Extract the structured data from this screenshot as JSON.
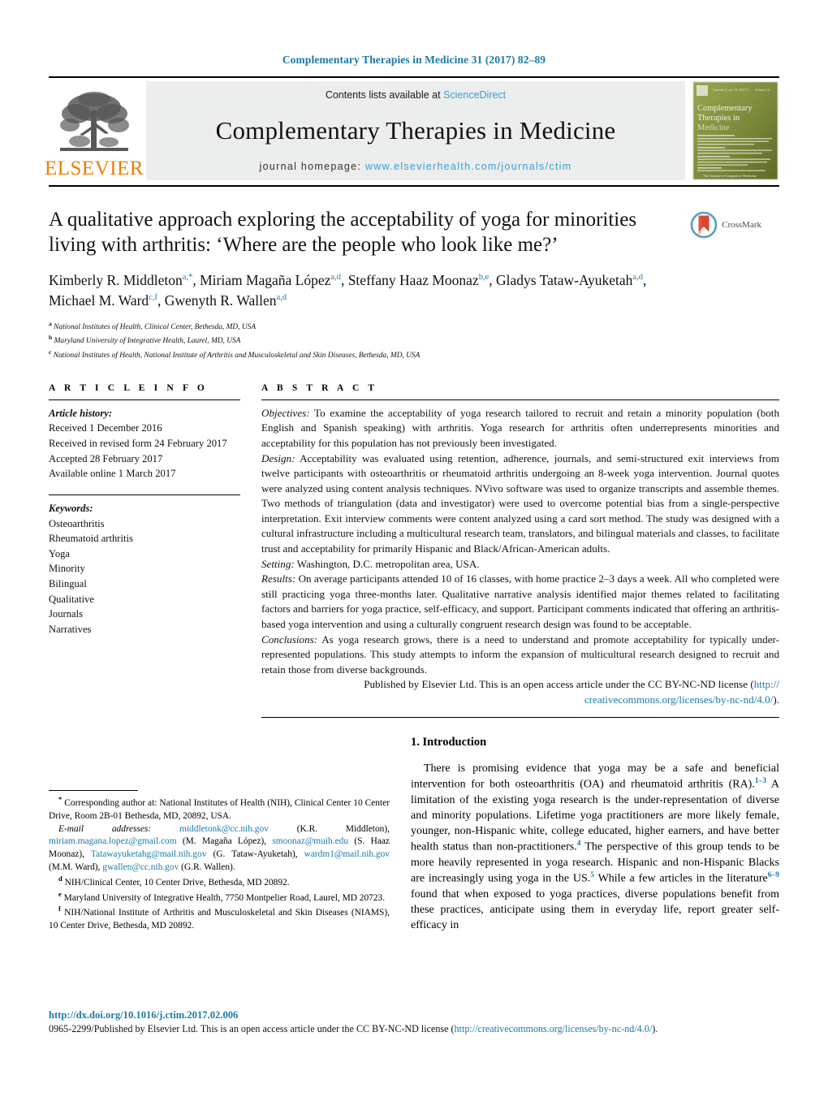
{
  "running_head": "Complementary Therapies in Medicine 31 (2017) 82–89",
  "masthead": {
    "publisher_name": "ELSEVIER",
    "contents_prefix": "Contents lists available at ",
    "contents_link": "ScienceDirect",
    "journal_title": "Complementary Therapies in Medicine",
    "homepage_prefix": "journal homepage: ",
    "homepage_url": "www.elsevierhealth.com/journals/ctim",
    "cover_title_line1": "Complementary",
    "cover_title_line2": "Therapies in",
    "cover_title_line3": "Medicine",
    "link_color": "#3a9fd0"
  },
  "crossmark": {
    "label": "CrossMark"
  },
  "article": {
    "title": "A qualitative approach exploring the acceptability of yoga for minorities living with arthritis: ‘Where are the people who look like me?’",
    "authors_html": "Kimberly R. Middleton<sup class=\"aff\">a,<span class=\"aff-black\">*</span></sup>, Miriam Magaña López<sup class=\"aff\">a,d</sup>, Steffany Haaz Moonaz<sup class=\"aff\">b,e</sup>, Gladys Tataw-Ayuketah<sup class=\"aff\">a,d</sup>, Michael M. Ward<sup class=\"aff\">c,f</sup>, Gwenyth R. Wallen<sup class=\"aff\">a,d</sup>",
    "affiliations": [
      {
        "marker": "a",
        "text": "National Institutes of Health, Clinical Center, Bethesda, MD, USA"
      },
      {
        "marker": "b",
        "text": "Maryland University of Integrative Health, Laurel, MD, USA"
      },
      {
        "marker": "c",
        "text": "National Institutes of Health, National Institute of Arthritis and Musculoskeletal and Skin Diseases, Bethesda, MD, USA"
      }
    ]
  },
  "article_info": {
    "heading": "A R T I C L E    I N F O",
    "history_label": "Article history:",
    "history": [
      "Received 1 December 2016",
      "Received in revised form 24 February 2017",
      "Accepted 28 February 2017",
      "Available online 1 March 2017"
    ],
    "keywords_label": "Keywords:",
    "keywords": [
      "Osteoarthritis",
      "Rheumatoid arthritis",
      "Yoga",
      "Minority",
      "Bilingual",
      "Qualitative",
      "Journals",
      "Narratives"
    ]
  },
  "abstract": {
    "heading": "A B S T R A C T",
    "objectives_label": "Objectives:",
    "objectives_text": " To examine the acceptability of yoga research tailored to recruit and retain a minority population (both English and Spanish speaking) with arthritis. Yoga research for arthritis often underrepresents minorities and acceptability for this population has not previously been investigated.",
    "design_label": "Design:",
    "design_text": " Acceptability was evaluated using retention, adherence, journals, and semi-structured exit interviews from twelve participants with osteoarthritis or rheumatoid arthritis undergoing an 8-week yoga intervention. Journal quotes were analyzed using content analysis techniques. NVivo software was used to organize transcripts and assemble themes. Two methods of triangulation (data and investigator) were used to overcome potential bias from a single-perspective interpretation. Exit interview comments were content analyzed using a card sort method. The study was designed with a cultural infrastructure including a multicultural research team, translators, and bilingual materials and classes, to facilitate trust and acceptability for primarily Hispanic and Black/African-American adults.",
    "setting_label": "Setting:",
    "setting_text": " Washington, D.C. metropolitan area, USA.",
    "results_label": "Results:",
    "results_text": " On average participants attended 10 of 16 classes, with home practice 2–3 days a week. All who completed were still practicing yoga three-months later. Qualitative narrative analysis identified major themes related to facilitating factors and barriers for yoga practice, self-efficacy, and support. Participant comments indicated that offering an arthritis-based yoga intervention and using a culturally congruent research design was found to be acceptable.",
    "conclusions_label": "Conclusions:",
    "conclusions_text": " As yoga research grows, there is a need to understand and promote acceptability for typically under-represented populations. This study attempts to inform the expansion of multicultural research designed to recruit and retain those from diverse backgrounds.",
    "license_prefix": "Published by Elsevier Ltd. This is an open access article under the CC BY-NC-ND license (",
    "license_url_line1": "http://",
    "license_url_line2": "creativecommons.org/licenses/by-nc-nd/4.0/",
    "license_suffix": ")."
  },
  "introduction": {
    "heading": "1.  Introduction",
    "paragraph_html": "There is promising evidence that yoga may be a safe and beneficial intervention for both osteoarthritis (OA) and rheumatoid arthritis (RA).<sup>1–3</sup> A limitation of the existing yoga research is the under-representation of diverse and minority populations. Lifetime yoga practitioners are more likely female, younger, non-Hispanic white, college educated, higher earners, and have better health status than non-practitioners.<sup>4</sup> The perspective of this group tends to be more heavily represented in yoga research. Hispanic and non-Hispanic Blacks are increasingly using yoga in the US.<sup>5</sup> While a few articles in the literature<sup>6–9</sup> found that when exposed to yoga practices, diverse populations benefit from these practices, anticipate using them in everyday life, report greater self-efficacy in"
  },
  "footnotes": {
    "corresponding_html": "<sup>*</sup> Corresponding author at: National Institutes of Health (NIH), Clinical Center 10 Center Drive, Room 2B-01 Bethesda, MD, 20892, USA.",
    "emails_html": "<span class=\"em\">E-mail addresses:</span> <span class=\"lnk\">middletonk@cc.nih.gov</span> (K.R. Middleton), <span class=\"lnk\">miriam.magana.lopez@gmail.com</span> (M. Magaña López), <span class=\"lnk\">smoonaz@muih.edu</span> (S. Haaz Moonaz), <span class=\"lnk\">Tatawayuketahg@mail.nih.gov</span> (G. Tataw-Ayuketah), <span class=\"lnk\">wardm1@mail.nih.gov</span> (M.M. Ward), <span class=\"lnk\">gwallen@cc.nih.gov</span> (G.R. Wallen).",
    "note_d_html": "<sup>d</sup> NIH/Clinical Center, 10 Center Drive, Bethesda, MD 20892.",
    "note_e_html": "<sup>e</sup> Maryland University of Integrative Health, 7750 Montpelier Road, Laurel, MD 20723.",
    "note_f_html": "<sup>f</sup> NIH/National Institute of Arthritis and Musculoskeletal and Skin Diseases (NIAMS), 10 Center Drive, Bethesda, MD 20892."
  },
  "page_footer": {
    "doi": "http://dx.doi.org/10.1016/j.ctim.2017.02.006",
    "issn_prefix": "0965-2299/Published by Elsevier Ltd. This is an open access article under the CC BY-NC-ND license (",
    "issn_link": "http://creativecommons.org/licenses/by-nc-nd/4.0/",
    "issn_suffix": ")."
  }
}
